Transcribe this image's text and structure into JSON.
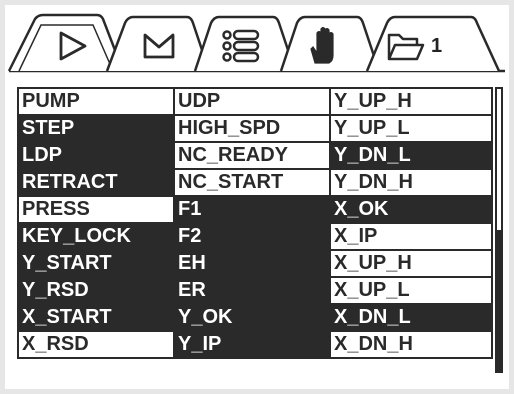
{
  "tabs": [
    {
      "id": "run",
      "icon": "play-icon",
      "label": ""
    },
    {
      "id": "manual",
      "icon": "m-icon",
      "label": ""
    },
    {
      "id": "list",
      "icon": "list-icon",
      "label": ""
    },
    {
      "id": "hand",
      "icon": "hand-icon",
      "label": ""
    },
    {
      "id": "folder",
      "icon": "folder-icon",
      "label": "1"
    }
  ],
  "active_tab": "run",
  "signals": {
    "columns": 3,
    "rows": [
      [
        {
          "label": "PUMP",
          "on": false
        },
        {
          "label": "UDP",
          "on": false
        },
        {
          "label": "Y_UP_H",
          "on": false
        }
      ],
      [
        {
          "label": "STEP",
          "on": true
        },
        {
          "label": "HIGH_SPD",
          "on": false
        },
        {
          "label": "Y_UP_L",
          "on": false
        }
      ],
      [
        {
          "label": "LDP",
          "on": true
        },
        {
          "label": "NC_READY",
          "on": false
        },
        {
          "label": "Y_DN_L",
          "on": true
        }
      ],
      [
        {
          "label": "RETRACT",
          "on": true
        },
        {
          "label": "NC_START",
          "on": false
        },
        {
          "label": "Y_DN_H",
          "on": false
        }
      ],
      [
        {
          "label": "PRESS",
          "on": false
        },
        {
          "label": "F1",
          "on": true
        },
        {
          "label": "X_OK",
          "on": true
        }
      ],
      [
        {
          "label": "KEY_LOCK",
          "on": true
        },
        {
          "label": "F2",
          "on": true
        },
        {
          "label": "X_IP",
          "on": false
        }
      ],
      [
        {
          "label": "Y_START",
          "on": true
        },
        {
          "label": "EH",
          "on": true
        },
        {
          "label": "X_UP_H",
          "on": false
        }
      ],
      [
        {
          "label": "Y_RSD",
          "on": true
        },
        {
          "label": "ER",
          "on": true
        },
        {
          "label": "X_UP_L",
          "on": false
        }
      ],
      [
        {
          "label": "X_START",
          "on": true
        },
        {
          "label": "Y_OK",
          "on": true
        },
        {
          "label": "X_DN_L",
          "on": true
        }
      ],
      [
        {
          "label": "X_RSD",
          "on": false
        },
        {
          "label": "Y_IP",
          "on": true
        },
        {
          "label": "X_DN_H",
          "on": false
        }
      ]
    ]
  },
  "scrollbar": {
    "position": 0.5
  },
  "colors": {
    "on_bg": "#2a2a2a",
    "off_bg": "#ffffff",
    "frame": "#2a2a2a",
    "screen_bg": "#e6e6e6"
  }
}
